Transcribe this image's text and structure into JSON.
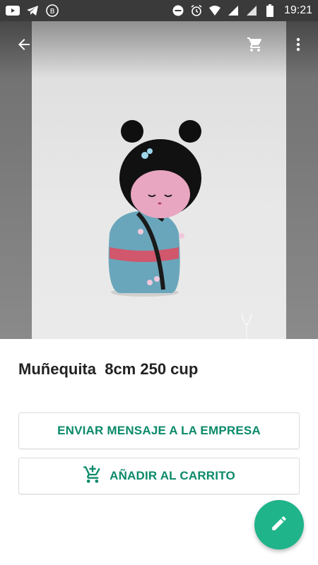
{
  "status_bar": {
    "time": "19:21",
    "icons": [
      "youtube-icon",
      "telegram-icon",
      "b-circle-icon",
      "dnd-icon",
      "alarm-icon",
      "wifi-icon",
      "signal-icon",
      "signal-icon",
      "battery-icon"
    ]
  },
  "product": {
    "title": "Muñequita  8cm 250 cup"
  },
  "actions": {
    "message_label": "ENVIAR MENSAJE A LA EMPRESA",
    "add_to_cart_label": "AÑADIR AL CARRITO"
  },
  "colors": {
    "accent": "#0a8a6a",
    "fab": "#1fb48a",
    "status_bar": "#3a3a3a"
  }
}
